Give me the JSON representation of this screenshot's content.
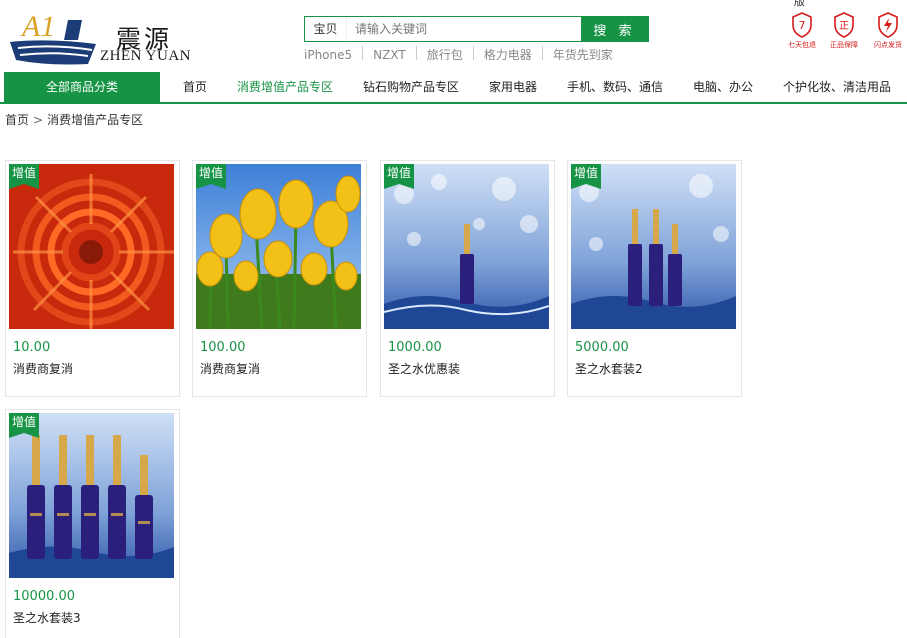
{
  "logo": {
    "mark_text": "A1",
    "name_cn": "震源",
    "name_en": "ZHEN YUAN"
  },
  "search": {
    "type_label": "宝贝",
    "placeholder": "请输入关键词",
    "button_label": "搜 索",
    "hot_words": [
      "iPhone5",
      "NZXT",
      "旅行包",
      "格力电器",
      "年货先到家"
    ]
  },
  "header_cut_text": "版",
  "services": [
    {
      "icon": "seven-day-return-icon",
      "glyph": "7",
      "label": "七天包退",
      "color": "#d7191a"
    },
    {
      "icon": "genuine-guarantee-icon",
      "glyph": "正",
      "label": "正品保障",
      "color": "#d7191a"
    },
    {
      "icon": "flash-delivery-icon",
      "glyph": "⚡",
      "label": "闪点发货",
      "color": "#d7191a"
    }
  ],
  "nav": {
    "all_categories": "全部商品分类",
    "items": [
      {
        "label": "首页",
        "active": false
      },
      {
        "label": "消费增值产品专区",
        "active": true
      },
      {
        "label": "钻石购物产品专区",
        "active": false
      },
      {
        "label": "家用电器",
        "active": false
      },
      {
        "label": "手机、数码、通信",
        "active": false
      },
      {
        "label": "电脑、办公",
        "active": false
      },
      {
        "label": "个护化妆、清洁用品",
        "active": false
      }
    ]
  },
  "breadcrumb": {
    "home": "首页",
    "separator": ">",
    "current": "消费增值产品专区"
  },
  "products": [
    {
      "badge": "增值",
      "price": "10.00",
      "name": "消费商复消",
      "image": "red-chrysanthemum"
    },
    {
      "badge": "增值",
      "price": "100.00",
      "name": "消费商复消",
      "image": "yellow-tulips"
    },
    {
      "badge": "增值",
      "price": "1000.00",
      "name": "圣之水优惠装",
      "image": "bottle-x1"
    },
    {
      "badge": "增值",
      "price": "5000.00",
      "name": "圣之水套装2",
      "image": "bottle-x3"
    },
    {
      "badge": "增值",
      "price": "10000.00",
      "name": "圣之水套装3",
      "image": "bottle-x5"
    }
  ],
  "colors": {
    "brand_green": "#179345",
    "service_red": "#d7191a",
    "logo_blue": "#1c3c78",
    "logo_gold": "#d9a32a"
  }
}
